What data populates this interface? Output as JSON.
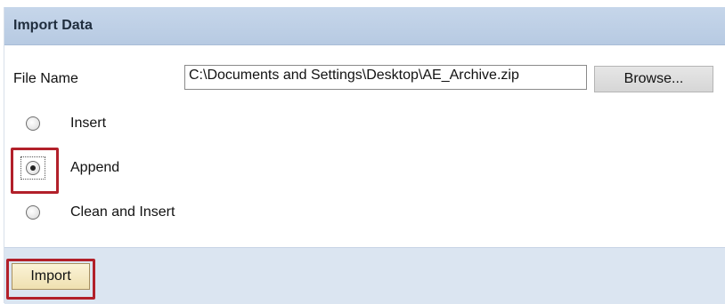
{
  "panel": {
    "title": "Import Data"
  },
  "file": {
    "label": "File Name",
    "value": "C:\\Documents and Settings\\Desktop\\AE_Archive.zip",
    "browse_label": "Browse..."
  },
  "options": [
    {
      "label": "Insert",
      "checked": false
    },
    {
      "label": "Append",
      "checked": true
    },
    {
      "label": "Clean and Insert",
      "checked": false
    }
  ],
  "actions": {
    "import_label": "Import"
  },
  "colors": {
    "header_bg": "#c6d6ea",
    "footer_bg": "#dbe5f1",
    "highlight": "#b2202a",
    "import_bg": "#f3e7bf"
  }
}
